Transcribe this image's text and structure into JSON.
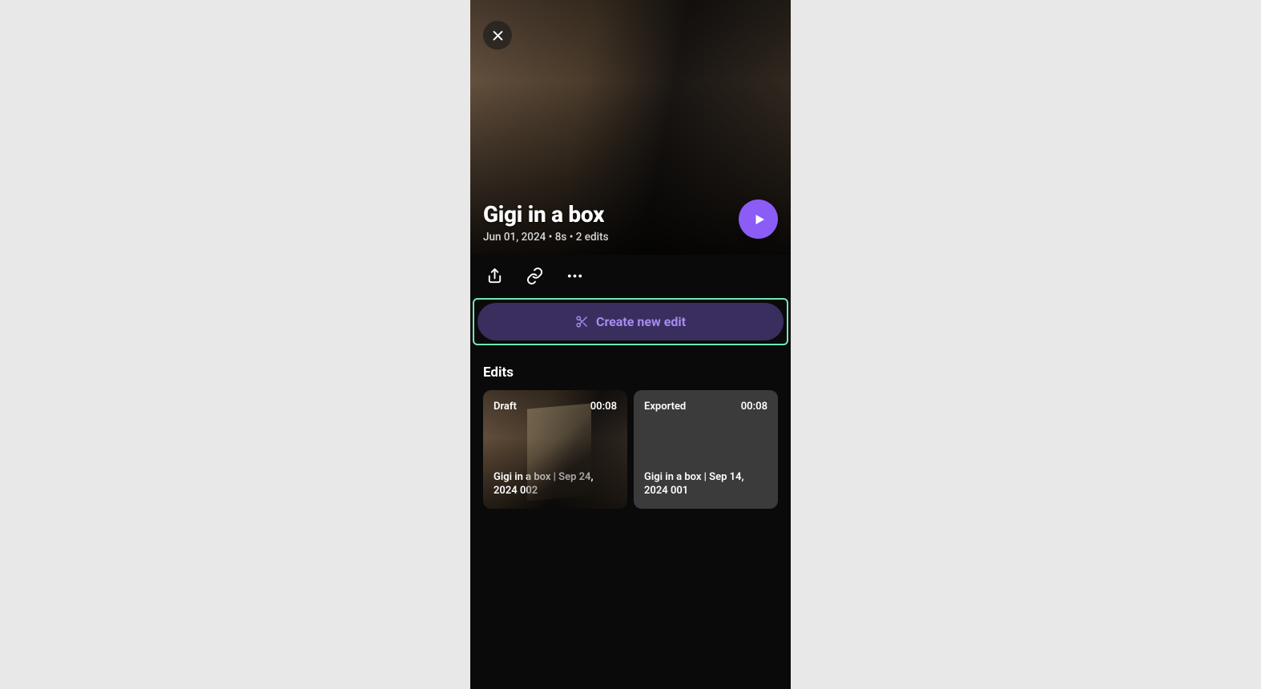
{
  "hero": {
    "title": "Gigi in a box",
    "meta": "Jun 01, 2024 • 8s • 2 edits"
  },
  "create": {
    "label": "Create new edit"
  },
  "section": {
    "edits_header": "Edits"
  },
  "edits": [
    {
      "status": "Draft",
      "duration": "00:08",
      "title": "Gigi in a box | Sep 24, 2024 002"
    },
    {
      "status": "Exported",
      "duration": "00:08",
      "title": "Gigi in a box | Sep 14, 2024 001"
    }
  ]
}
